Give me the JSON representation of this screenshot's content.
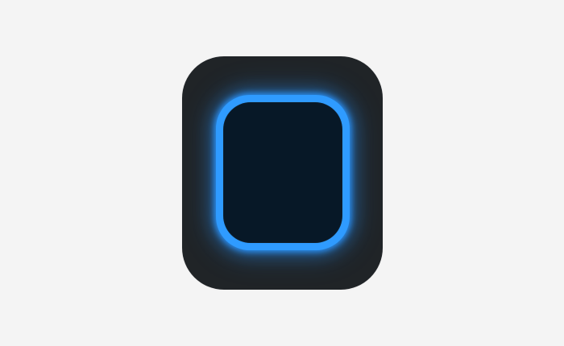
{
  "app_icon": {
    "name": "widget-icon",
    "colors": {
      "background": "#f4f4f4",
      "icon_body": "#202427",
      "glow_ring": "#2f9bff",
      "screen": "#071827"
    }
  }
}
